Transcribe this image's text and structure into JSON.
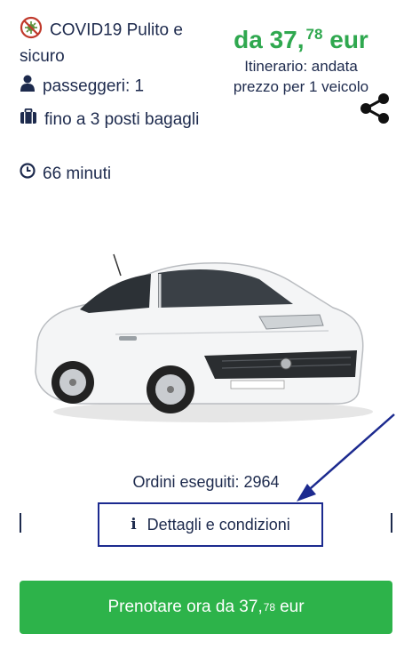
{
  "features": {
    "covid": "COVID19 Pulito e sicuro",
    "passengers": "passeggeri: 1",
    "luggage": "fino a 3 posti bagagli",
    "duration": "66 minuti"
  },
  "price": {
    "prefix": "da 37,",
    "cents": "78",
    "currency": "eur",
    "itinerary": "Itinerario: andata",
    "per_vehicle": "prezzo per 1 veicolo"
  },
  "orders_text": "Ordini eseguiti: 2964",
  "details_label": "Dettagli e condizioni",
  "book_button": {
    "prefix": "Prenotare ora da 37,",
    "cents": "78",
    "currency": "eur"
  },
  "icons": {
    "covid": "virus-icon",
    "passengers": "user-icon",
    "luggage": "suitcase-icon",
    "duration": "clock-icon",
    "share": "share-icon",
    "details": "info-icon"
  },
  "colors": {
    "price_green": "#2fa84f",
    "button_green": "#2db34a",
    "text_navy": "#1d2a4d",
    "annotation_blue": "#1c2a8f",
    "virus_red": "#c0392b"
  }
}
